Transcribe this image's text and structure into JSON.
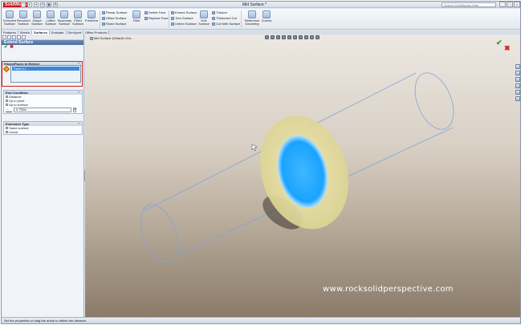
{
  "app": {
    "logo": "SolidWorks",
    "doc_title": "Mid Surface *",
    "help_search_placeholder": "Search SolidWorks Help"
  },
  "window_controls": [
    "_",
    "□",
    "×"
  ],
  "quick_access": [
    "□",
    "▸",
    "▾",
    "⟲",
    "▣",
    "⚙"
  ],
  "ribbon": {
    "big_buttons": [
      "Extruded Surface",
      "Revolved Surface",
      "Swept Surface",
      "Lofted Surface",
      "Boundary Surface",
      "Filled Surface",
      "Freeform",
      "Planar Surface",
      "Fillet",
      "Knit Surface",
      "Reference Geometry",
      "Curves"
    ],
    "small_buttons": [
      "Planar Surface",
      "Offset Surface",
      "Ruled Surface",
      "Delete Face",
      "Replace Face",
      "Extend Surface",
      "Trim Surface",
      "Untrim Surface",
      "Thicken",
      "Thickened Cut",
      "Cut With Surface"
    ]
  },
  "tabs": [
    {
      "label": "Features",
      "active": false
    },
    {
      "label": "Sketch",
      "active": false
    },
    {
      "label": "Surfaces",
      "active": true
    },
    {
      "label": "Evaluate",
      "active": false
    },
    {
      "label": "DimXpert",
      "active": false
    },
    {
      "label": "Office Products",
      "active": false
    }
  ],
  "property_manager": {
    "title": "Extend Surface",
    "ok_symbol": "✔",
    "cancel_symbol": "✖",
    "edges_group": {
      "title": "Edges/Faces to Extend",
      "selected_item": "Face<1>"
    },
    "end_condition": {
      "title": "End Condition:",
      "options": [
        {
          "label": "Distance",
          "selected": true
        },
        {
          "label": "Up to point",
          "selected": false
        },
        {
          "label": "Up to surface",
          "selected": false
        }
      ],
      "distance_value": "0.750in"
    },
    "extension_type": {
      "title": "Extension Type",
      "options": [
        {
          "label": "Same surface",
          "selected": true
        },
        {
          "label": "Linear",
          "selected": false
        }
      ]
    }
  },
  "viewport": {
    "tree_label": "Mid Surface (Default<<De...",
    "confirm_ok": "✔",
    "confirm_cancel": "✖",
    "watermark": "www.rocksolidperspective.com"
  },
  "status_bar": {
    "message": "Set the properties or drag the arrow to define the distance."
  },
  "colors": {
    "selection_face": "#1aa3ff",
    "extend_preview": "#e9e3a0",
    "ribbon_bg": "#e3e9f0",
    "panel_title": "#4c6c9a"
  }
}
